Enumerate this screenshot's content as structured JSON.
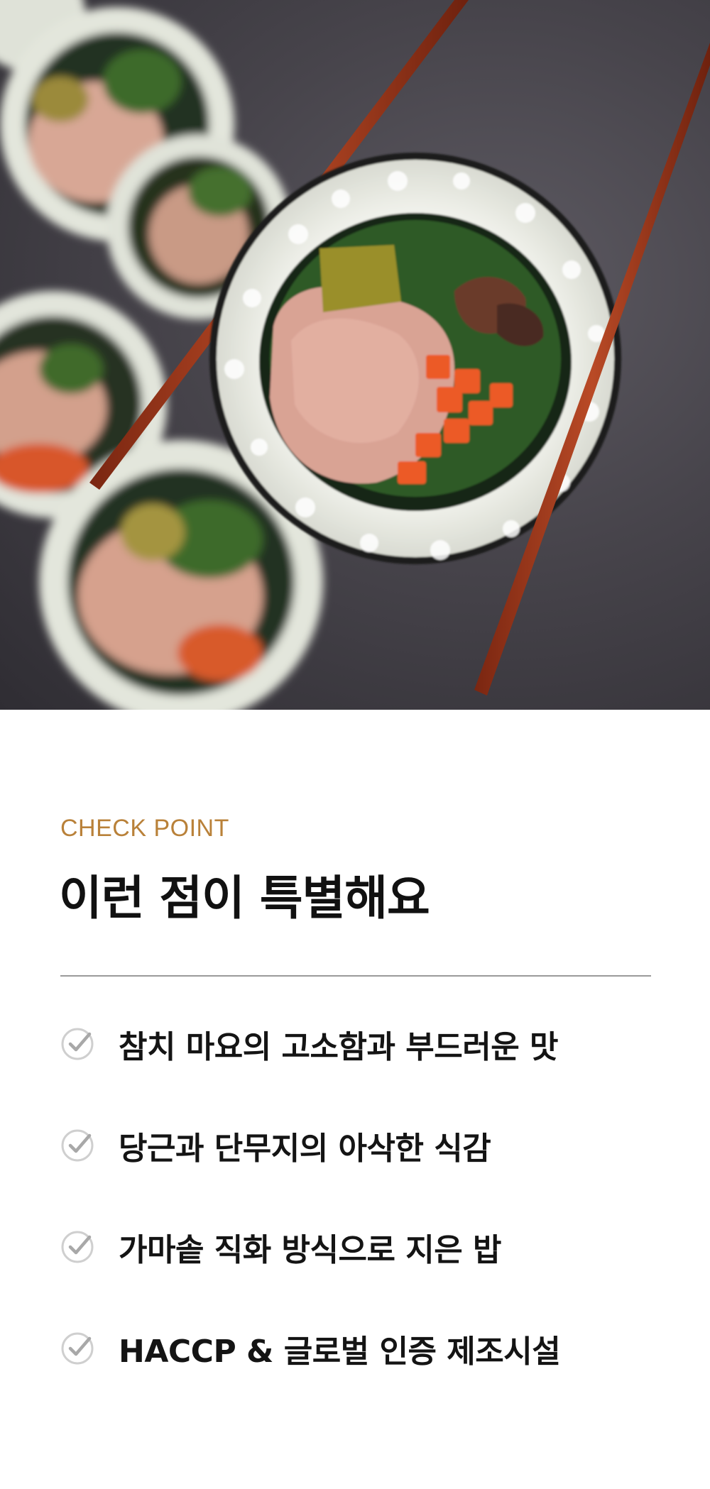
{
  "hero": {
    "image": "kimbap-roll-chopsticks-photo"
  },
  "section": {
    "eyebrow": "CHECK POINT",
    "title": "이런 점이 특별해요",
    "accent_color": "#b98139",
    "divider_color": "#9a9a9a"
  },
  "points": [
    {
      "icon": "check-icon",
      "text": "참치 마요의 고소함과 부드러운 맛"
    },
    {
      "icon": "check-icon",
      "text": "당근과 단무지의 아삭한 식감"
    },
    {
      "icon": "check-icon",
      "text": "가마솥 직화 방식으로 지은 밥"
    },
    {
      "icon": "check-icon",
      "text": "HACCP & 글로벌 인증 제조시설"
    }
  ]
}
